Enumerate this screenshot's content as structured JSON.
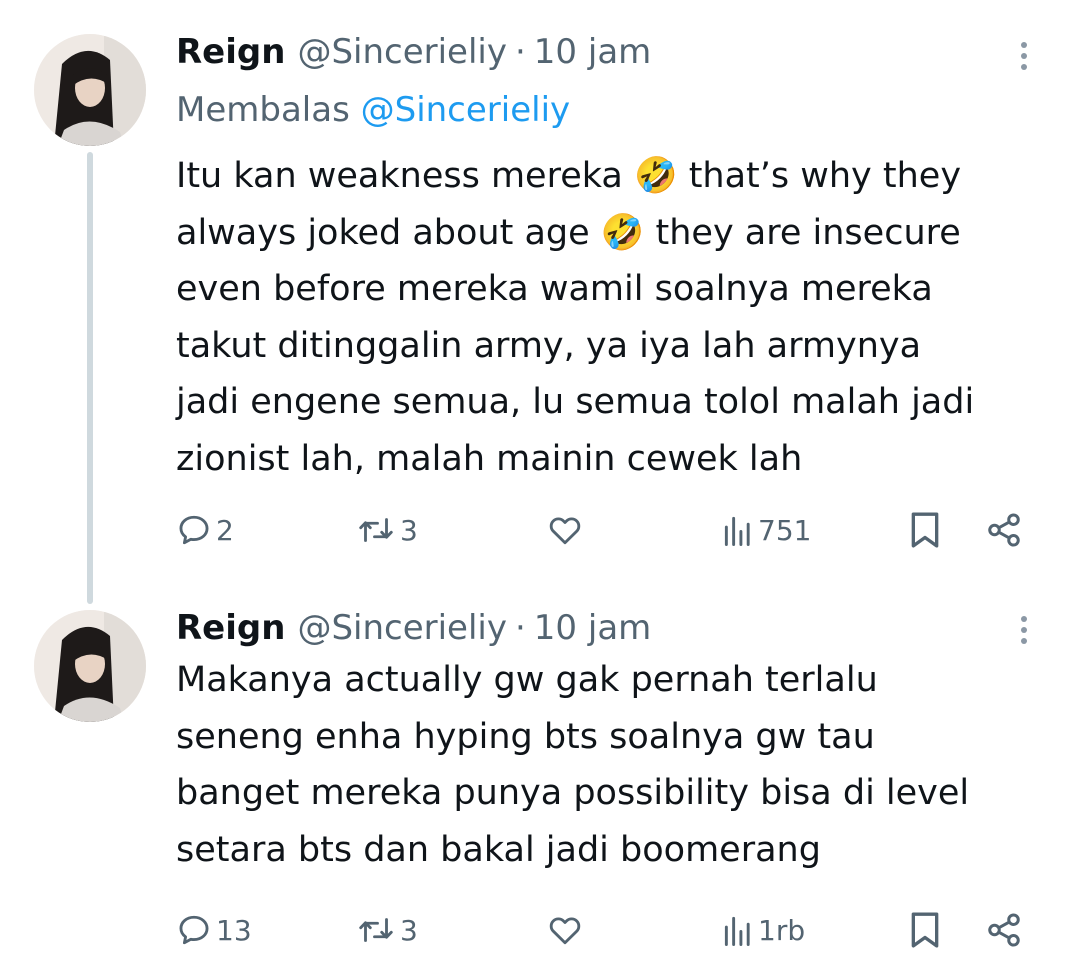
{
  "tweets": [
    {
      "author_name": "Reign",
      "handle": "@Sincerieliy",
      "separator": "·",
      "time": "10 jam",
      "reply_prefix": "Membalas",
      "reply_handle": "@Sincerieliy",
      "text_lines": [
        [
          "Itu kan weakness mereka ",
          "🤣",
          " that’s why they"
        ],
        [
          "always joked about age ",
          "🤣",
          " they are insecure"
        ],
        [
          "even before mereka wamil soalnya mereka"
        ],
        [
          "takut ditinggalin army, ya iya lah armynya"
        ],
        [
          "jadi engene semua, lu semua tolol malah jadi"
        ],
        [
          "zionist lah, malah mainin cewek lah"
        ]
      ],
      "stats": {
        "replies": "2",
        "retweets": "3",
        "views": "751"
      }
    },
    {
      "author_name": "Reign",
      "handle": "@Sincerieliy",
      "separator": "·",
      "time": "10 jam",
      "text_lines": [
        [
          "Makanya actually gw gak pernah terlalu"
        ],
        [
          "seneng enha hyping bts soalnya gw tau"
        ],
        [
          "banget mereka punya possibility bisa di level"
        ],
        [
          "setara bts dan bakal jadi boomerang"
        ]
      ],
      "stats": {
        "replies": "13",
        "retweets": "3",
        "views": "1rb"
      }
    }
  ],
  "icons": {
    "reply": "reply-icon",
    "retweet": "retweet-icon",
    "like": "like-heart-icon",
    "views": "views-bar-chart-icon",
    "bookmark": "bookmark-icon",
    "share": "share-icon",
    "more": "more-options-icon"
  },
  "colors": {
    "text": "#0f1419",
    "secondary": "#536471",
    "link": "#1d9bf0",
    "thread_line": "#cfd9de",
    "emoji_face": "#ffc83d"
  }
}
